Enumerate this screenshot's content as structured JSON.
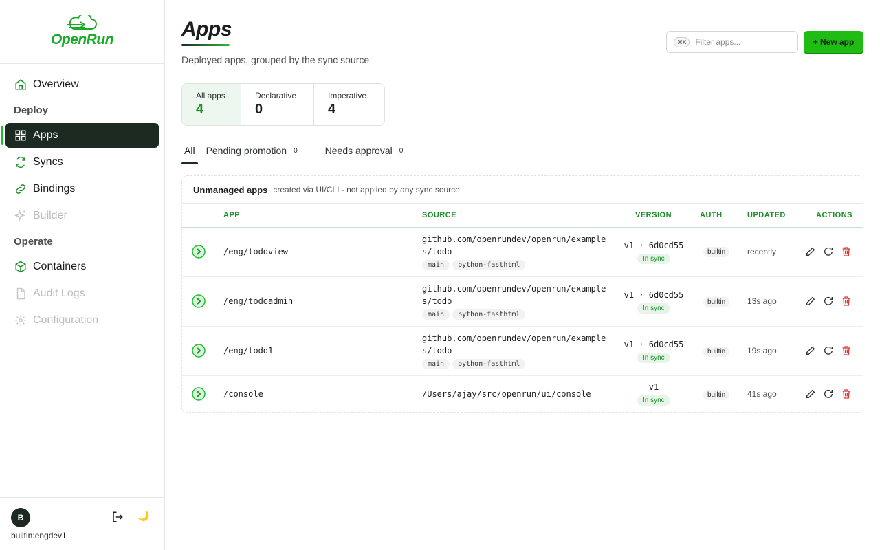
{
  "brand": {
    "name": "OpenRun"
  },
  "sidebar": {
    "items": [
      {
        "label": "Overview"
      },
      {
        "section": "Deploy"
      },
      {
        "label": "Apps"
      },
      {
        "label": "Syncs"
      },
      {
        "label": "Bindings"
      },
      {
        "label": "Builder"
      },
      {
        "section": "Operate"
      },
      {
        "label": "Containers"
      },
      {
        "label": "Audit Logs"
      },
      {
        "label": "Configuration"
      }
    ],
    "user": {
      "initial": "B",
      "name": "builtin:engdev1"
    }
  },
  "header": {
    "title": "Apps",
    "subtitle": "Deployed apps, grouped by the sync source",
    "filter_kbd": "⌘K",
    "filter_placeholder": "Filter apps...",
    "new_button": "+ New app"
  },
  "stats": [
    {
      "label": "All apps",
      "value": "4"
    },
    {
      "label": "Declarative",
      "value": "0"
    },
    {
      "label": "Imperative",
      "value": "4"
    }
  ],
  "tabs": [
    {
      "label": "All"
    },
    {
      "label": "Pending promotion",
      "count": "0"
    },
    {
      "label": "Needs approval",
      "count": "0"
    }
  ],
  "panel": {
    "title": "Unmanaged apps",
    "subtitle": "created via UI/CLI - not applied by any sync source",
    "columns": [
      "APP",
      "SOURCE",
      "VERSION",
      "AUTH",
      "UPDATED",
      "ACTIONS"
    ],
    "rows": [
      {
        "app": "/eng/todoview",
        "source_line1": "github.com/openrundev/openrun/example",
        "source_line2": "s/todo",
        "chips": [
          "main",
          "python-fasthtml"
        ],
        "version": "v1 · 6d0cd55",
        "sync": "In sync",
        "auth": "builtin",
        "updated": "recently"
      },
      {
        "app": "/eng/todoadmin",
        "source_line1": "github.com/openrundev/openrun/example",
        "source_line2": "s/todo",
        "chips": [
          "main",
          "python-fasthtml"
        ],
        "version": "v1 · 6d0cd55",
        "sync": "In sync",
        "auth": "builtin",
        "updated": "13s ago"
      },
      {
        "app": "/eng/todo1",
        "source_line1": "github.com/openrundev/openrun/example",
        "source_line2": "s/todo",
        "chips": [
          "main",
          "python-fasthtml"
        ],
        "version": "v1 · 6d0cd55",
        "sync": "In sync",
        "auth": "builtin",
        "updated": "19s ago"
      },
      {
        "app": "/console",
        "source_line1": "/Users/ajay/src/openrun/ui/console",
        "version": "v1",
        "sync": "In sync",
        "auth": "builtin",
        "updated": "41s ago"
      }
    ]
  },
  "colors": {
    "accent": "#1fbd13",
    "dark": "#1c2a22",
    "danger": "#d93a3a"
  },
  "icons": [
    "cloud-logo-icon",
    "home-icon",
    "grid-icon",
    "sync-icon",
    "link-icon",
    "sparkle-icon",
    "box-icon",
    "doc-icon",
    "gear-icon",
    "logout-icon",
    "moon-icon",
    "play-circle-icon",
    "edit-icon",
    "refresh-icon",
    "trash-icon"
  ]
}
